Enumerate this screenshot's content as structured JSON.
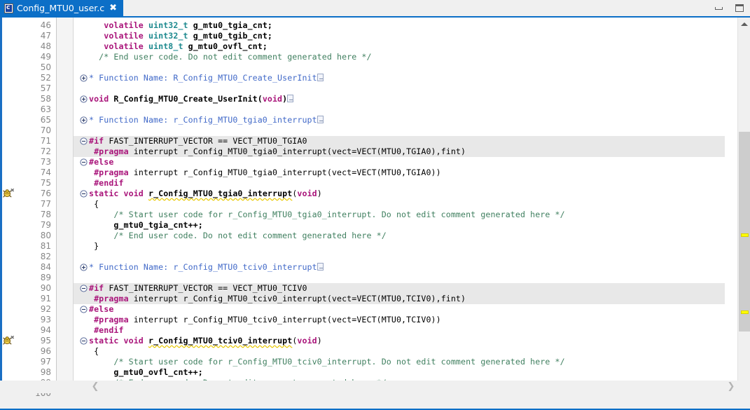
{
  "window": {
    "minimize_icon": "minimize-icon",
    "maximize_icon": "maximize-icon"
  },
  "tab": {
    "title": "Config_MTU0_user.c",
    "close_label": "✖",
    "file_icon": "c-source-file-icon",
    "accent_color": "#0c6fc7"
  },
  "editor": {
    "first_visible_line": 46,
    "last_visible_line": 100,
    "colors": {
      "keyword": "#a9147a",
      "type": "#1e8a8f",
      "comment": "#3f7f5f",
      "link": "#4169c8",
      "inactive_block_bg": "#e8e8e8",
      "warning_marker": "#ffff00"
    },
    "lines": [
      {
        "n": "46",
        "highlight": false,
        "fold": null,
        "marker": null,
        "tokens": [
          {
            "c": "plain",
            "t": "   "
          },
          {
            "c": "kw",
            "t": "volatile"
          },
          {
            "c": "plain",
            "t": " "
          },
          {
            "c": "typ",
            "t": "uint32_t"
          },
          {
            "c": "bld",
            "t": " g_mtu0_tgia_cnt;"
          }
        ]
      },
      {
        "n": "47",
        "highlight": false,
        "fold": null,
        "marker": null,
        "tokens": [
          {
            "c": "plain",
            "t": "   "
          },
          {
            "c": "kw",
            "t": "volatile"
          },
          {
            "c": "plain",
            "t": " "
          },
          {
            "c": "typ",
            "t": "uint32_t"
          },
          {
            "c": "bld",
            "t": " g_mtu0_tgib_cnt;"
          }
        ]
      },
      {
        "n": "48",
        "highlight": false,
        "fold": null,
        "marker": null,
        "tokens": [
          {
            "c": "plain",
            "t": "   "
          },
          {
            "c": "kw",
            "t": "volatile"
          },
          {
            "c": "plain",
            "t": " "
          },
          {
            "c": "typ",
            "t": "uint8_t"
          },
          {
            "c": "bld",
            "t": " g_mtu0_ovfl_cnt;"
          }
        ]
      },
      {
        "n": "49",
        "highlight": false,
        "fold": null,
        "marker": null,
        "tokens": [
          {
            "c": "cmt",
            "t": "  /* End user code. Do not edit comment generated here */"
          }
        ]
      },
      {
        "n": "50",
        "highlight": false,
        "fold": null,
        "marker": null,
        "tokens": []
      },
      {
        "n": "52",
        "highlight": false,
        "fold": "expand",
        "marker": null,
        "tokens": [
          {
            "c": "blue",
            "t": "* Function Name: R_Config_MTU0_Create_UserInit"
          },
          {
            "c": "collapsed",
            "t": ""
          }
        ]
      },
      {
        "n": "57",
        "highlight": false,
        "fold": null,
        "marker": null,
        "tokens": []
      },
      {
        "n": "58",
        "highlight": false,
        "fold": "expand",
        "marker": null,
        "tokens": [
          {
            "c": "kw",
            "t": "void"
          },
          {
            "c": "bld",
            "t": " R_Config_MTU0_Create_UserInit("
          },
          {
            "c": "kw",
            "t": "void"
          },
          {
            "c": "bld",
            "t": ")"
          },
          {
            "c": "collapsed",
            "t": ""
          }
        ]
      },
      {
        "n": "63",
        "highlight": false,
        "fold": null,
        "marker": null,
        "tokens": []
      },
      {
        "n": "65",
        "highlight": false,
        "fold": "expand",
        "marker": null,
        "tokens": [
          {
            "c": "blue",
            "t": "* Function Name: r_Config_MTU0_tgia0_interrupt"
          },
          {
            "c": "collapsed",
            "t": ""
          }
        ]
      },
      {
        "n": "70",
        "highlight": false,
        "fold": null,
        "marker": null,
        "tokens": []
      },
      {
        "n": "71",
        "highlight": true,
        "fold": "collapse",
        "marker": null,
        "tokens": [
          {
            "c": "pre",
            "t": "#if"
          },
          {
            "c": "plain",
            "t": " FAST_INTERRUPT_VECTOR == VECT_MTU0_TGIA0"
          }
        ]
      },
      {
        "n": "72",
        "highlight": true,
        "fold": null,
        "marker": null,
        "tokens": [
          {
            "c": "plain",
            "t": " "
          },
          {
            "c": "pre",
            "t": "#pragma"
          },
          {
            "c": "plain",
            "t": " interrupt r_Config_MTU0_tgia0_interrupt(vect=VECT(MTU0,TGIA0),fint)"
          }
        ]
      },
      {
        "n": "73",
        "highlight": false,
        "fold": "collapse",
        "marker": null,
        "tokens": [
          {
            "c": "pre",
            "t": "#else"
          }
        ]
      },
      {
        "n": "74",
        "highlight": false,
        "fold": null,
        "marker": null,
        "tokens": [
          {
            "c": "plain",
            "t": " "
          },
          {
            "c": "pre",
            "t": "#pragma"
          },
          {
            "c": "plain",
            "t": " interrupt r_Config_MTU0_tgia0_interrupt(vect=VECT(MTU0,TGIA0))"
          }
        ]
      },
      {
        "n": "75",
        "highlight": false,
        "fold": null,
        "marker": null,
        "tokens": [
          {
            "c": "plain",
            "t": " "
          },
          {
            "c": "pre",
            "t": "#endif"
          }
        ]
      },
      {
        "n": "76",
        "highlight": false,
        "fold": "collapse",
        "marker": "bug-icon",
        "tokens": [
          {
            "c": "kw",
            "t": "static void"
          },
          {
            "c": "plain",
            "t": " "
          },
          {
            "c": "fnname",
            "t": "r_Config_MTU0_tgia0_interrupt"
          },
          {
            "c": "plain",
            "t": "("
          },
          {
            "c": "kw",
            "t": "void"
          },
          {
            "c": "plain",
            "t": ")"
          }
        ]
      },
      {
        "n": "77",
        "highlight": false,
        "fold": null,
        "marker": null,
        "tokens": [
          {
            "c": "plain",
            "t": " {"
          }
        ]
      },
      {
        "n": "78",
        "highlight": false,
        "fold": null,
        "marker": null,
        "tokens": [
          {
            "c": "cmt",
            "t": "     /* Start user code for r_Config_MTU0_tgia0_interrupt. Do not edit comment generated here */"
          }
        ]
      },
      {
        "n": "79",
        "highlight": false,
        "fold": null,
        "marker": null,
        "tokens": [
          {
            "c": "bld",
            "t": "     g_mtu0_tgia_cnt++;"
          }
        ]
      },
      {
        "n": "80",
        "highlight": false,
        "fold": null,
        "marker": null,
        "tokens": [
          {
            "c": "cmt",
            "t": "     /* End user code. Do not edit comment generated here */"
          }
        ]
      },
      {
        "n": "81",
        "highlight": false,
        "fold": null,
        "marker": null,
        "tokens": [
          {
            "c": "plain",
            "t": " }"
          }
        ]
      },
      {
        "n": "82",
        "highlight": false,
        "fold": null,
        "marker": null,
        "tokens": []
      },
      {
        "n": "84",
        "highlight": false,
        "fold": "expand",
        "marker": null,
        "tokens": [
          {
            "c": "blue",
            "t": "* Function Name: r_Config_MTU0_tciv0_interrupt"
          },
          {
            "c": "collapsed",
            "t": ""
          }
        ]
      },
      {
        "n": "89",
        "highlight": false,
        "fold": null,
        "marker": null,
        "tokens": []
      },
      {
        "n": "90",
        "highlight": true,
        "fold": "collapse",
        "marker": null,
        "tokens": [
          {
            "c": "pre",
            "t": "#if"
          },
          {
            "c": "plain",
            "t": " FAST_INTERRUPT_VECTOR == VECT_MTU0_TCIV0"
          }
        ]
      },
      {
        "n": "91",
        "highlight": true,
        "fold": null,
        "marker": null,
        "tokens": [
          {
            "c": "plain",
            "t": " "
          },
          {
            "c": "pre",
            "t": "#pragma"
          },
          {
            "c": "plain",
            "t": " interrupt r_Config_MTU0_tciv0_interrupt(vect=VECT(MTU0,TCIV0),fint)"
          }
        ]
      },
      {
        "n": "92",
        "highlight": false,
        "fold": "collapse",
        "marker": null,
        "tokens": [
          {
            "c": "pre",
            "t": "#else"
          }
        ]
      },
      {
        "n": "93",
        "highlight": false,
        "fold": null,
        "marker": null,
        "tokens": [
          {
            "c": "plain",
            "t": " "
          },
          {
            "c": "pre",
            "t": "#pragma"
          },
          {
            "c": "plain",
            "t": " interrupt r_Config_MTU0_tciv0_interrupt(vect=VECT(MTU0,TCIV0))"
          }
        ]
      },
      {
        "n": "94",
        "highlight": false,
        "fold": null,
        "marker": null,
        "tokens": [
          {
            "c": "plain",
            "t": " "
          },
          {
            "c": "pre",
            "t": "#endif"
          }
        ]
      },
      {
        "n": "95",
        "highlight": false,
        "fold": "collapse",
        "marker": "bug-icon",
        "tokens": [
          {
            "c": "kw",
            "t": "static void"
          },
          {
            "c": "plain",
            "t": " "
          },
          {
            "c": "fnname",
            "t": "r_Config_MTU0_tciv0_interrupt"
          },
          {
            "c": "plain",
            "t": "("
          },
          {
            "c": "kw",
            "t": "void"
          },
          {
            "c": "plain",
            "t": ")"
          }
        ]
      },
      {
        "n": "96",
        "highlight": false,
        "fold": null,
        "marker": null,
        "tokens": [
          {
            "c": "plain",
            "t": " {"
          }
        ]
      },
      {
        "n": "97",
        "highlight": false,
        "fold": null,
        "marker": null,
        "tokens": [
          {
            "c": "cmt",
            "t": "     /* Start user code for r_Config_MTU0_tciv0_interrupt. Do not edit comment generated here */"
          }
        ]
      },
      {
        "n": "98",
        "highlight": false,
        "fold": null,
        "marker": null,
        "tokens": [
          {
            "c": "bld",
            "t": "     g_mtu0_ovfl_cnt++;"
          }
        ]
      },
      {
        "n": "99",
        "highlight": false,
        "fold": null,
        "marker": null,
        "tokens": [
          {
            "c": "cmt",
            "t": "     /* End user code. Do not edit comment generated here */"
          }
        ]
      },
      {
        "n": "100",
        "highlight": false,
        "fold": null,
        "marker": null,
        "tokens": [
          {
            "c": "plain",
            "t": " }"
          }
        ]
      }
    ]
  },
  "vertical_scrollbar": {
    "up_arrow": "scroll-up-arrow",
    "down_arrow": "scroll-down-arrow",
    "thumb_top_pct": 29,
    "thumb_height_pct": 57,
    "warning_markers": [
      {
        "label": "warning-marker-tgia0",
        "top_pct": 58
      },
      {
        "label": "warning-marker-tciv0",
        "top_pct": 80
      }
    ]
  },
  "horizontal_scrollbar": {
    "left_arrow": "❮",
    "right_arrow": "❯"
  }
}
